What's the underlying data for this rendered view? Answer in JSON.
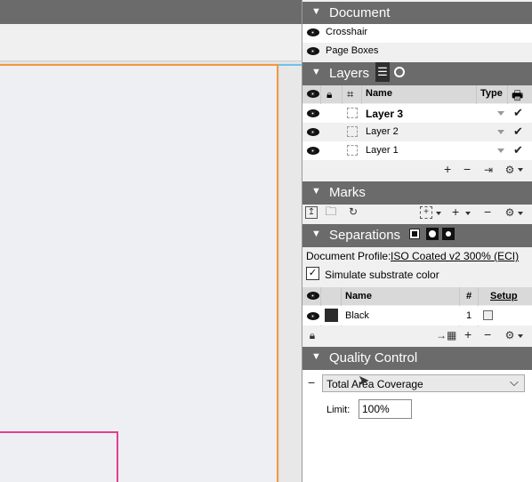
{
  "document_panel": {
    "title": "Document",
    "items": [
      {
        "label": "Crosshair"
      },
      {
        "label": "Page Boxes"
      }
    ]
  },
  "layers_panel": {
    "title": "Layers",
    "columns": {
      "name": "Name",
      "type": "Type"
    },
    "layers": [
      {
        "name": "Layer 3",
        "selected": true
      },
      {
        "name": "Layer 2",
        "selected": false
      },
      {
        "name": "Layer 1",
        "selected": false
      }
    ],
    "toolbar": {
      "add": "+",
      "remove": "−"
    }
  },
  "marks_panel": {
    "title": "Marks",
    "toolbar": {
      "add": "+",
      "remove": "−"
    }
  },
  "separations_panel": {
    "title": "Separations",
    "profile_label": "Document Profile:",
    "profile_value": "ISO Coated v2 300% (ECI)",
    "simulate_label": "Simulate substrate color",
    "simulate_checked": true,
    "columns": {
      "name": "Name",
      "number": "#",
      "setup": "Setup"
    },
    "separations": [
      {
        "name": "Black",
        "number": "1",
        "color": "#2b2b2b"
      }
    ],
    "toolbar": {
      "add": "+",
      "remove": "−"
    }
  },
  "quality_panel": {
    "title": "Quality Control",
    "collapse": "−",
    "check_select": "Total Area Coverage",
    "limit_label": "Limit:",
    "limit_value": "100%"
  },
  "colors": {
    "panel_header": "#6b6b6b",
    "page_border": "#f5963c",
    "bleed_box": "#e0408f"
  }
}
